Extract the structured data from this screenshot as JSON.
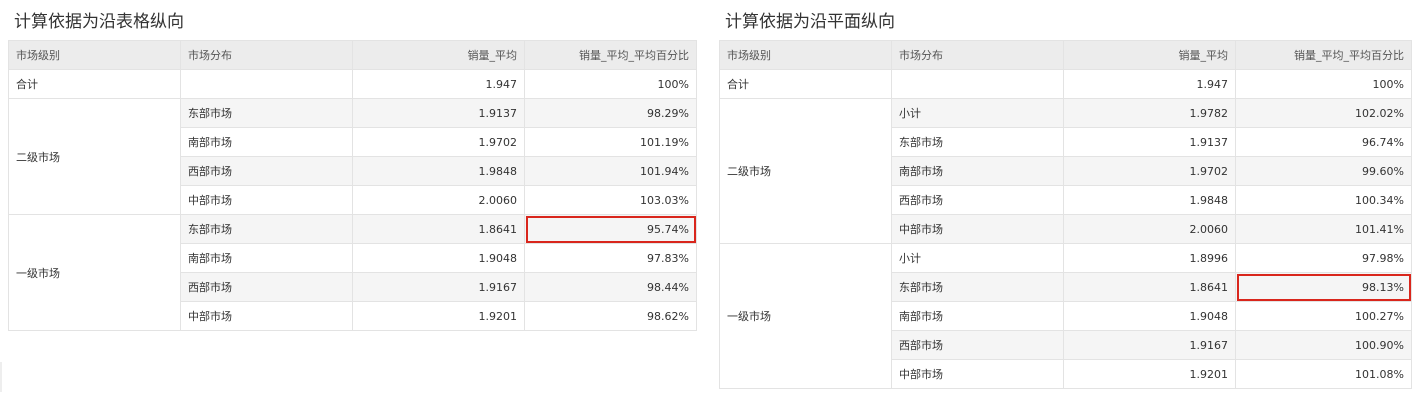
{
  "left": {
    "title": "计算依据为沿表格纵向",
    "headers": [
      "市场级别",
      "市场分布",
      "销量_平均",
      "销量_平均_平均百分比"
    ],
    "total": {
      "label": "合计",
      "value": "1.947",
      "pct": "100%"
    },
    "groups": [
      {
        "level": "二级市场",
        "rows": [
          {
            "dist": "东部市场",
            "value": "1.9137",
            "pct": "98.29%"
          },
          {
            "dist": "南部市场",
            "value": "1.9702",
            "pct": "101.19%"
          },
          {
            "dist": "西部市场",
            "value": "1.9848",
            "pct": "101.94%"
          },
          {
            "dist": "中部市场",
            "value": "2.0060",
            "pct": "103.03%"
          }
        ]
      },
      {
        "level": "一级市场",
        "rows": [
          {
            "dist": "东部市场",
            "value": "1.8641",
            "pct": "95.74%",
            "highlight": true
          },
          {
            "dist": "南部市场",
            "value": "1.9048",
            "pct": "97.83%"
          },
          {
            "dist": "西部市场",
            "value": "1.9167",
            "pct": "98.44%"
          },
          {
            "dist": "中部市场",
            "value": "1.9201",
            "pct": "98.62%"
          }
        ]
      }
    ]
  },
  "right": {
    "title": "计算依据为沿平面纵向",
    "headers": [
      "市场级别",
      "市场分布",
      "销量_平均",
      "销量_平均_平均百分比"
    ],
    "total": {
      "label": "合计",
      "value": "1.947",
      "pct": "100%"
    },
    "groups": [
      {
        "level": "二级市场",
        "rows": [
          {
            "dist": "小计",
            "value": "1.9782",
            "pct": "102.02%"
          },
          {
            "dist": "东部市场",
            "value": "1.9137",
            "pct": "96.74%"
          },
          {
            "dist": "南部市场",
            "value": "1.9702",
            "pct": "99.60%"
          },
          {
            "dist": "西部市场",
            "value": "1.9848",
            "pct": "100.34%"
          },
          {
            "dist": "中部市场",
            "value": "2.0060",
            "pct": "101.41%"
          }
        ]
      },
      {
        "level": "一级市场",
        "rows": [
          {
            "dist": "小计",
            "value": "1.8996",
            "pct": "97.98%"
          },
          {
            "dist": "东部市场",
            "value": "1.8641",
            "pct": "98.13%",
            "highlight": true
          },
          {
            "dist": "南部市场",
            "value": "1.9048",
            "pct": "100.27%"
          },
          {
            "dist": "西部市场",
            "value": "1.9167",
            "pct": "100.90%"
          },
          {
            "dist": "中部市场",
            "value": "1.9201",
            "pct": "101.08%"
          }
        ]
      }
    ]
  },
  "colors": {
    "header_bg": "#ececec",
    "stripe_bg": "#f5f5f5",
    "border": "#e3e3e3",
    "highlight": "#d9261c"
  }
}
